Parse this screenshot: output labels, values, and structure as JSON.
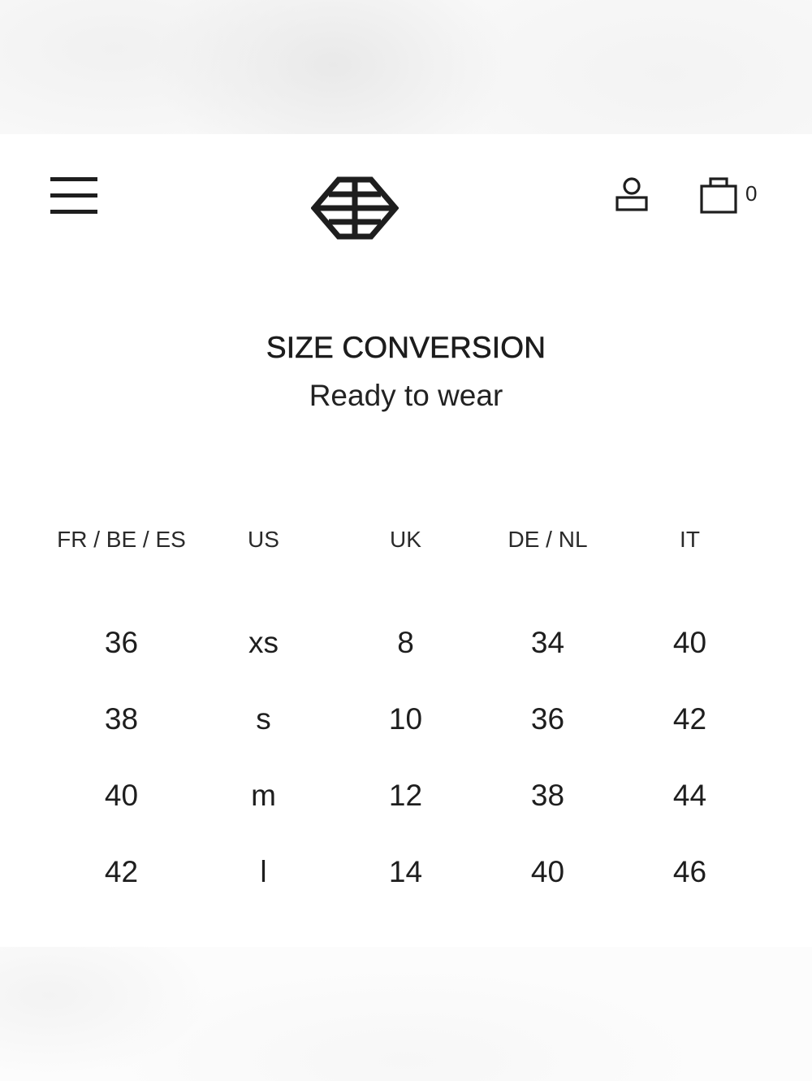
{
  "header": {
    "menu_icon": "hamburger-menu-icon",
    "logo_icon": "brand-logo-icon",
    "account_icon": "user-account-icon",
    "cart_icon": "shopping-bag-icon",
    "cart_count": "0"
  },
  "main": {
    "title": "SIZE CONVERSION",
    "subtitle": "Ready to wear"
  },
  "size_table": {
    "columns": [
      "FR / BE / ES",
      "US",
      "UK",
      "DE / NL",
      "IT"
    ],
    "rows": [
      [
        "36",
        "xs",
        "8",
        "34",
        "40"
      ],
      [
        "38",
        "s",
        "10",
        "36",
        "42"
      ],
      [
        "40",
        "m",
        "12",
        "38",
        "44"
      ],
      [
        "42",
        "l",
        "14",
        "40",
        "46"
      ]
    ]
  },
  "colors": {
    "text": "#1c1c1c",
    "background": "#ffffff"
  }
}
